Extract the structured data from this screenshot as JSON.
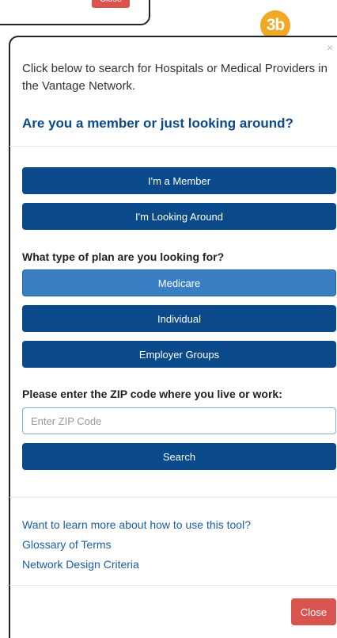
{
  "top_modal": {
    "close_label": "Close"
  },
  "callout": {
    "label": "3b"
  },
  "modal": {
    "close_x": "×",
    "intro": "Click below to search for Hospitals or Medical Providers in the Vantage Network.",
    "question": "Are you a member or just looking around?",
    "member_buttons": [
      "I'm a Member",
      "I'm Looking Around"
    ],
    "plan_question": "What type of plan are you looking for?",
    "plan_buttons": [
      "Medicare",
      "Individual",
      "Employer Groups"
    ],
    "plan_selected": "Medicare",
    "zip_label": "Please enter the ZIP code where you live or work:",
    "zip_placeholder": "Enter ZIP Code",
    "zip_value": "",
    "search_label": "Search",
    "links": [
      "Want to learn more about how to use this tool?",
      "Glossary of Terms",
      "Network Design Criteria"
    ],
    "close_label": "Close"
  },
  "colors": {
    "primary": "#0a4a8a",
    "active": "#3a7fc4",
    "danger": "#d9534f",
    "callout": "#f0a924",
    "link": "#1a5ea8"
  }
}
